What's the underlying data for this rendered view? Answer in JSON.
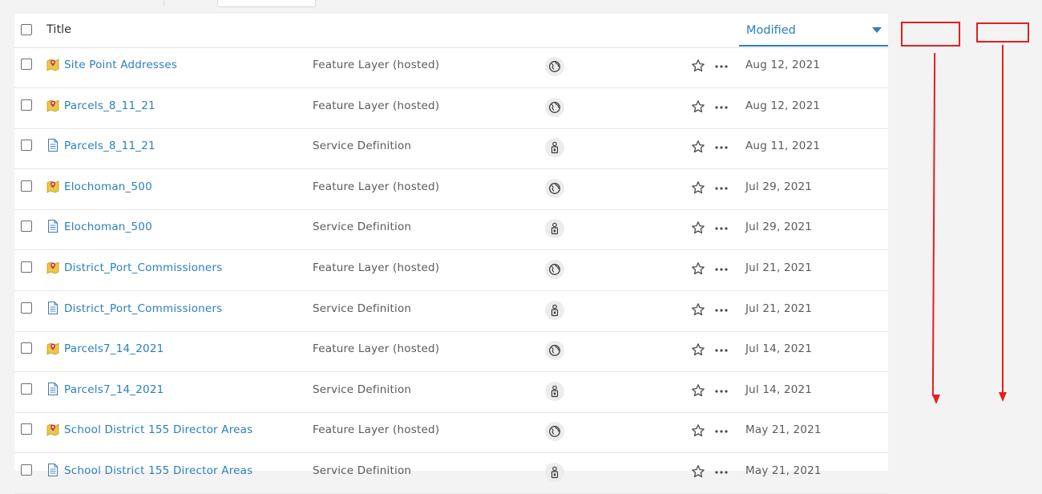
{
  "header": {
    "title_label": "Title",
    "modified_label": "Modified",
    "sort_direction": "descending"
  },
  "colors": {
    "link": "#2a7fbd",
    "annotation": "#e61e1e",
    "feature_layer_icon": "#e8c84a"
  },
  "rows": [
    {
      "title": "Site Point Addresses",
      "type": "Feature Layer (hosted)",
      "item_icon": "feature-layer-icon",
      "sharing_icon": "globe-icon",
      "modified": "Aug 12, 2021"
    },
    {
      "title": "Parcels_8_11_21",
      "type": "Feature Layer (hosted)",
      "item_icon": "feature-layer-icon",
      "sharing_icon": "globe-icon",
      "modified": "Aug 12, 2021"
    },
    {
      "title": "Parcels_8_11_21",
      "type": "Service Definition",
      "item_icon": "document-icon",
      "sharing_icon": "lock-person-icon",
      "modified": "Aug 11, 2021"
    },
    {
      "title": "Elochoman_500",
      "type": "Feature Layer (hosted)",
      "item_icon": "feature-layer-icon",
      "sharing_icon": "globe-icon",
      "modified": "Jul 29, 2021"
    },
    {
      "title": "Elochoman_500",
      "type": "Service Definition",
      "item_icon": "document-icon",
      "sharing_icon": "lock-person-icon",
      "modified": "Jul 29, 2021"
    },
    {
      "title": "District_Port_Commissioners",
      "type": "Feature Layer (hosted)",
      "item_icon": "feature-layer-icon",
      "sharing_icon": "globe-icon",
      "modified": "Jul 21, 2021"
    },
    {
      "title": "District_Port_Commissioners",
      "type": "Service Definition",
      "item_icon": "document-icon",
      "sharing_icon": "lock-person-icon",
      "modified": "Jul 21, 2021"
    },
    {
      "title": "Parcels7_14_2021",
      "type": "Feature Layer (hosted)",
      "item_icon": "feature-layer-icon",
      "sharing_icon": "globe-icon",
      "modified": "Jul 14, 2021"
    },
    {
      "title": "Parcels7_14_2021",
      "type": "Service Definition",
      "item_icon": "document-icon",
      "sharing_icon": "lock-person-icon",
      "modified": "Jul 14, 2021"
    },
    {
      "title": "School District 155 Director Areas",
      "type": "Feature Layer (hosted)",
      "item_icon": "feature-layer-icon",
      "sharing_icon": "globe-icon",
      "modified": "May 21, 2021"
    },
    {
      "title": "School District 155 Director Areas",
      "type": "Service Definition",
      "item_icon": "document-icon",
      "sharing_icon": "lock-person-icon",
      "modified": "May 21, 2021"
    }
  ]
}
